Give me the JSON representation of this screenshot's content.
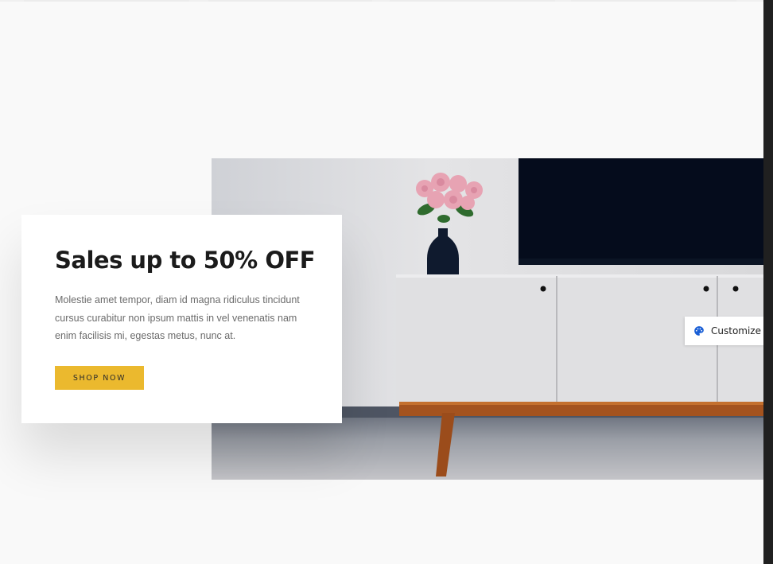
{
  "promo": {
    "title": "Sales up to 50% OFF",
    "description": "Molestie amet tempor, diam id magna ridiculus tincidunt cursus curabitur non ipsum mattis in vel venenatis nam enim facilisis mi, egestas metus, nunc at.",
    "button_label": "SHOP NOW"
  },
  "customize": {
    "label": "Customize",
    "icon": "palette-icon"
  },
  "hero": {
    "image": "tv-stand-with-flowers-photo"
  },
  "colors": {
    "accent": "#ebb92e",
    "page_background": "#f9f9f9",
    "customize_icon": "#1a5fd6"
  }
}
